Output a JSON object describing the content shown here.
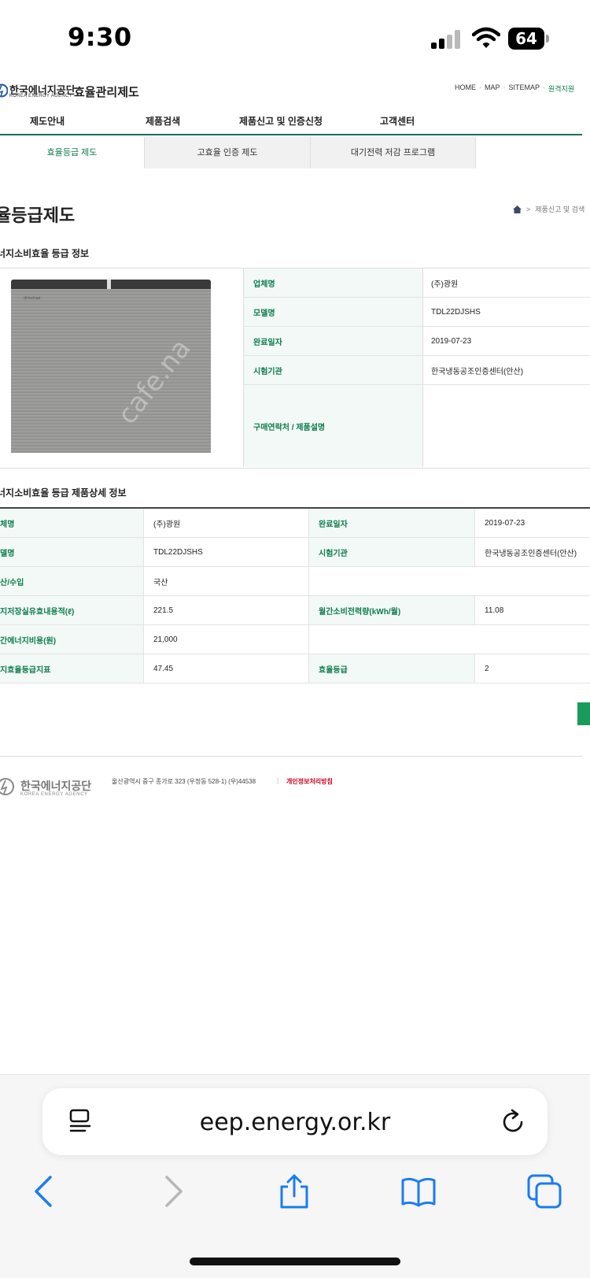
{
  "status_bar": {
    "time": "9:30",
    "battery": "64"
  },
  "header": {
    "logo_ko": "한국에너지공단",
    "logo_en": "KOREA ENERGY AGENCY",
    "site_title": "효율관리제도",
    "util_links": [
      "HOME",
      "MAP",
      "SITEMAP",
      "원격지원"
    ]
  },
  "gnb": [
    "제도안내",
    "제품검색",
    "제품신고 및 인증신청",
    "고객센터"
  ],
  "subtabs": [
    "효율등급 제도",
    "고효율 인증 제도",
    "대기전력 저감 프로그램"
  ],
  "page": {
    "title": "율등급제도",
    "breadcrumb": "제품신고 및 검색"
  },
  "section1": {
    "title": "너지소비효율 등급 정보",
    "rows": [
      {
        "label": "업체명",
        "value": "(주)광원"
      },
      {
        "label": "모델명",
        "value": "TDL22DJSHS"
      },
      {
        "label": "완료일자",
        "value": "2019-07-23"
      },
      {
        "label": "시험기관",
        "value": "한국냉동공조인증센터(안산)"
      },
      {
        "label": "구매연락처 / 제품설명",
        "value": ""
      }
    ],
    "image_label": "refrigerator-product-photo",
    "watermark": "cafe.na"
  },
  "section2": {
    "title": "너지소비효율 등급 제품상세 정보",
    "rows": [
      {
        "l1": "체명",
        "v1": "(주)광원",
        "l2": "완료일자",
        "v2": "2019-07-23"
      },
      {
        "l1": "델명",
        "v1": "TDL22DJSHS",
        "l2": "시험기관",
        "v2": "한국냉동공조인증센터(안산)"
      },
      {
        "l1": "산/수입",
        "v1": "국산",
        "l2": "",
        "v2": ""
      },
      {
        "l1": "지저장실유효내용적(ℓ)",
        "v1": "221.5",
        "l2": "월간소비전력량(kWh/월)",
        "v2": "11.08"
      },
      {
        "l1": "간에너지비용(원)",
        "v1": "21,000",
        "l2": "",
        "v2": ""
      },
      {
        "l1": "지효율등급지표",
        "v1": "47.45",
        "l2": "효율등급",
        "v2": "2"
      }
    ]
  },
  "footer": {
    "logo_ko": "한국에너지공단",
    "logo_en": "KOREA ENERGY AGENCY",
    "address": "울산광역시 중구 종가로 323 (우정동 528-1) (우)44538",
    "separator": "|",
    "privacy": "개인정보처리방침"
  },
  "browser": {
    "url": "eep.energy.or.kr"
  },
  "colors": {
    "accent": "#0c7d4d",
    "label_bg": "#f3f9f6",
    "privacy": "#d0021b"
  }
}
